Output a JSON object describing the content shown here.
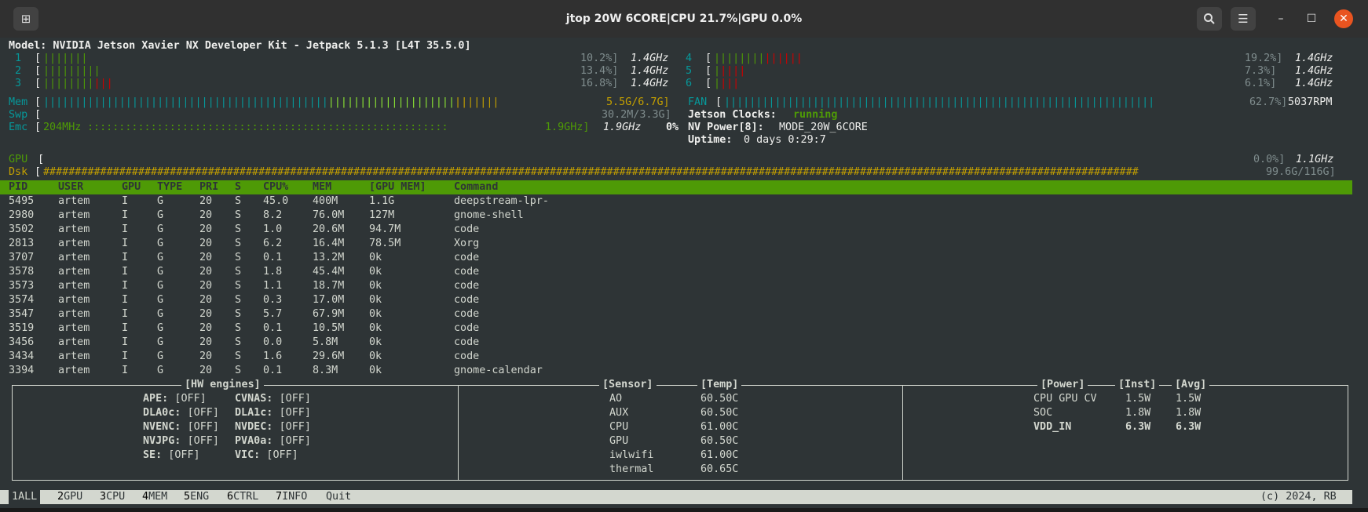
{
  "window": {
    "title": "jtop 20W 6CORE|CPU 21.7%|GPU 0.0%",
    "new_tab_icon": "new-tab-icon",
    "search_icon": "search-icon",
    "menu_icon": "hamburger-menu-icon"
  },
  "model_line": "Model: NVIDIA Jetson Xavier NX Developer Kit - Jetpack 5.1.3 [L4T 35.5.0]",
  "cpus": [
    {
      "id": "1",
      "pct": "10.2%]",
      "freq": "1.4GHz",
      "green": 7,
      "red": 0
    },
    {
      "id": "2",
      "pct": "13.4%]",
      "freq": "1.4GHz",
      "green": 9,
      "red": 0
    },
    {
      "id": "3",
      "pct": "16.8%]",
      "freq": "1.4GHz",
      "green": 8,
      "red": 3
    },
    {
      "id": "4",
      "pct": "19.2%]",
      "freq": "1.4GHz",
      "green": 8,
      "red": 6
    },
    {
      "id": "5",
      "pct": "7.3%]",
      "freq": "1.4GHz",
      "green": 1,
      "red": 4
    },
    {
      "id": "6",
      "pct": "6.1%]",
      "freq": "1.4GHz",
      "green": 1,
      "red": 3
    }
  ],
  "mem": {
    "label": "Mem",
    "value": "5.5G/6.7G]"
  },
  "fan": {
    "label": "FAN",
    "pct": "62.7%]",
    "rpm": "5037RPM"
  },
  "swp": {
    "label": "Swp",
    "value": "30.2M/3.3G]"
  },
  "jetson_clocks": {
    "label": "Jetson Clocks:",
    "value": "running"
  },
  "emc": {
    "label": "Emc",
    "min": "204MHz",
    "max": "1.9GHz]",
    "freq": "1.9GHz",
    "pct": "0%"
  },
  "nvpower": {
    "label": "NV Power[8]:",
    "value": "MODE_20W_6CORE"
  },
  "uptime": {
    "label": "Uptime:",
    "value": "0 days 0:29:7"
  },
  "gpu": {
    "label": "GPU",
    "pct": "0.0%]",
    "freq": "1.1GHz"
  },
  "dsk": {
    "label": "Dsk",
    "value": "99.6G/116G]"
  },
  "table": {
    "headers": [
      "PID",
      "USER",
      "GPU",
      "TYPE",
      "PRI",
      "S",
      "CPU%",
      "MEM",
      "[GPU MEM]",
      "Command"
    ],
    "rows": [
      [
        "5495",
        "artem",
        "I",
        "G",
        "20",
        "S",
        "45.0",
        "400M",
        "1.1G",
        "deepstream-lpr-"
      ],
      [
        "2980",
        "artem",
        "I",
        "G",
        "20",
        "S",
        "8.2",
        "76.0M",
        "127M",
        "gnome-shell"
      ],
      [
        "3502",
        "artem",
        "I",
        "G",
        "20",
        "S",
        "1.0",
        "20.6M",
        "94.7M",
        "code"
      ],
      [
        "2813",
        "artem",
        "I",
        "G",
        "20",
        "S",
        "6.2",
        "16.4M",
        "78.5M",
        "Xorg"
      ],
      [
        "3707",
        "artem",
        "I",
        "G",
        "20",
        "S",
        "0.1",
        "13.2M",
        "0k",
        "code"
      ],
      [
        "3578",
        "artem",
        "I",
        "G",
        "20",
        "S",
        "1.8",
        "45.4M",
        "0k",
        "code"
      ],
      [
        "3573",
        "artem",
        "I",
        "G",
        "20",
        "S",
        "1.1",
        "18.7M",
        "0k",
        "code"
      ],
      [
        "3574",
        "artem",
        "I",
        "G",
        "20",
        "S",
        "0.3",
        "17.0M",
        "0k",
        "code"
      ],
      [
        "3547",
        "artem",
        "I",
        "G",
        "20",
        "S",
        "5.7",
        "67.9M",
        "0k",
        "code"
      ],
      [
        "3519",
        "artem",
        "I",
        "G",
        "20",
        "S",
        "0.1",
        "10.5M",
        "0k",
        "code"
      ],
      [
        "3456",
        "artem",
        "I",
        "G",
        "20",
        "S",
        "0.0",
        "5.8M",
        "0k",
        "code"
      ],
      [
        "3434",
        "artem",
        "I",
        "G",
        "20",
        "S",
        "1.6",
        "29.6M",
        "0k",
        "code"
      ],
      [
        "3394",
        "artem",
        "I",
        "G",
        "20",
        "S",
        "0.1",
        "8.3M",
        "0k",
        "gnome-calendar"
      ]
    ]
  },
  "hw_engines": {
    "title": "[HW engines]",
    "rows": [
      {
        "a_label": "APE:",
        "a_val": "[OFF]",
        "b_label": "CVNAS:",
        "b_val": "[OFF]"
      },
      {
        "a_label": "DLA0c:",
        "a_val": "[OFF]",
        "b_label": "DLA1c:",
        "b_val": "[OFF]"
      },
      {
        "a_label": "NVENC:",
        "a_val": "[OFF]",
        "b_label": "NVDEC:",
        "b_val": "[OFF]"
      },
      {
        "a_label": "NVJPG:",
        "a_val": "[OFF]",
        "b_label": "PVA0a:",
        "b_val": "[OFF]"
      },
      {
        "a_label": "SE:",
        "a_val": "[OFF]",
        "b_label": "VIC:",
        "b_val": "[OFF]"
      }
    ]
  },
  "sensors": {
    "title_sensor": "[Sensor]",
    "title_temp": "[Temp]",
    "rows": [
      {
        "name": "AO",
        "temp": "60.50C"
      },
      {
        "name": "AUX",
        "temp": "60.50C"
      },
      {
        "name": "CPU",
        "temp": "61.00C"
      },
      {
        "name": "GPU",
        "temp": "60.50C"
      },
      {
        "name": "iwlwifi",
        "temp": "61.00C"
      },
      {
        "name": "thermal",
        "temp": "60.65C"
      }
    ]
  },
  "power": {
    "title_power": "[Power]",
    "title_inst": "[Inst]",
    "title_avg": "[Avg]",
    "rows": [
      {
        "name": "CPU GPU CV",
        "inst": "1.5W",
        "avg": "1.5W"
      },
      {
        "name": "SOC",
        "inst": "1.8W",
        "avg": "1.8W"
      },
      {
        "name": "VDD_IN",
        "inst": "6.3W",
        "avg": "6.3W"
      }
    ]
  },
  "footer": {
    "tabs": [
      {
        "num": "1",
        "label": "ALL"
      },
      {
        "num": "2",
        "label": "GPU"
      },
      {
        "num": "3",
        "label": "CPU"
      },
      {
        "num": "4",
        "label": "MEM"
      },
      {
        "num": "5",
        "label": "ENG"
      },
      {
        "num": "6",
        "label": "CTRL"
      },
      {
        "num": "7",
        "label": "INFO"
      },
      {
        "num": "",
        "label": "Quit"
      }
    ],
    "copyright": "(c) 2024, RB"
  },
  "colors": {
    "accent_green": "#4e9a06",
    "cyan": "#06989a",
    "red": "#cc0000",
    "yellow": "#c4a000"
  }
}
